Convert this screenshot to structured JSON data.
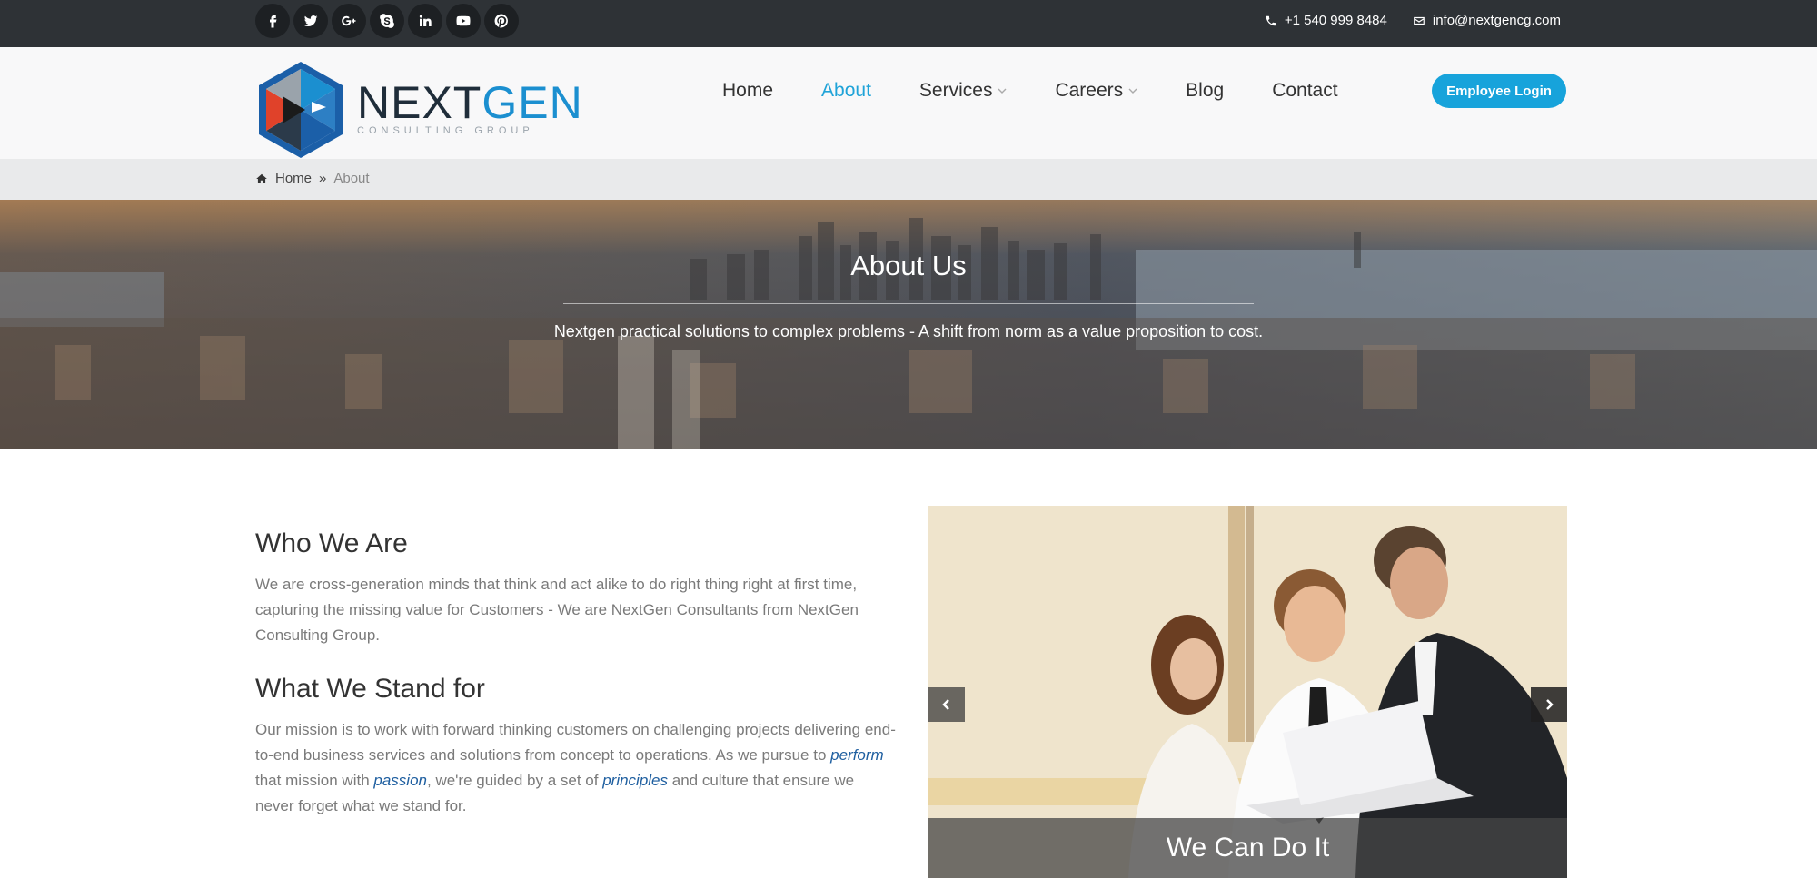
{
  "topbar": {
    "social": [
      "facebook-icon",
      "twitter-icon",
      "google-plus-icon",
      "skype-icon",
      "linkedin-icon",
      "youtube-icon",
      "pinterest-icon"
    ],
    "phone": "+1 540 999 8484",
    "email": "info@nextgencg.com"
  },
  "header": {
    "logo_nex": "NEXT",
    "logo_gen": "GEN",
    "logo_sub": "CONSULTING GROUP",
    "nav": [
      {
        "label": "Home",
        "active": false
      },
      {
        "label": "About",
        "active": true
      },
      {
        "label": "Services",
        "active": false
      },
      {
        "label": "Careers",
        "active": false
      },
      {
        "label": "Blog",
        "active": false
      },
      {
        "label": "Contact",
        "active": false
      }
    ],
    "login_label": "Employee Login",
    "accent_color": "#17a3db"
  },
  "breadcrumb": {
    "home": "Home",
    "separator": "»",
    "current": "About"
  },
  "hero": {
    "title": "About Us",
    "subtitle": "Nextgen practical solutions to complex problems - A shift from norm as a value proposition to cost."
  },
  "content": {
    "who_title": "Who We Are",
    "who_text": "We are cross-generation minds that think and act alike to do right thing right at first time, capturing the missing value for Customers - We are NextGen Consultants from NextGen Consulting Group.",
    "stand_title": "What We Stand for",
    "stand_text_1": "Our mission is to work with forward thinking customers on challenging projects delivering end-to-end business services and solutions from concept to operations. As we pursue to ",
    "stand_em_1": "perform",
    "stand_text_2": " that mission with ",
    "stand_em_2": "passion",
    "stand_text_3": ", we're guided by a set of ",
    "stand_em_3": "principles",
    "stand_text_4": " and culture that ensure we never forget what we stand for."
  },
  "slider": {
    "caption": "We Can Do It"
  }
}
